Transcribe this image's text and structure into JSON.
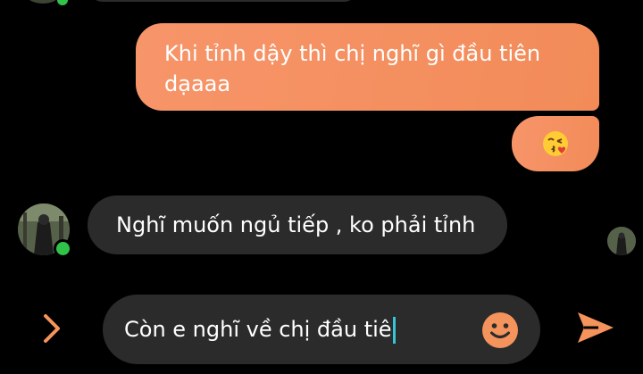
{
  "messages": [
    {
      "direction": "outgoing",
      "text": "Khi tỉnh dậy thì chị nghĩ gì đầu tiên dạaaa"
    },
    {
      "direction": "outgoing",
      "emoji": "face-blowing-kiss"
    },
    {
      "direction": "incoming",
      "text": "Nghĩ muốn ngủ tiếp , ko phải tỉnh"
    }
  ],
  "composer": {
    "value": "Còn e nghĩ về chị đầu tiê",
    "emoji_icon": "smiley-icon",
    "send_icon": "send-icon",
    "expand_icon": "chevron-right-icon"
  },
  "colors": {
    "background": "#000000",
    "outgoing_bubble": "#f28b58",
    "incoming_bubble": "#2b2b2b",
    "accent": "#f5935c",
    "online": "#31c24a",
    "caret": "#35c6d8"
  }
}
